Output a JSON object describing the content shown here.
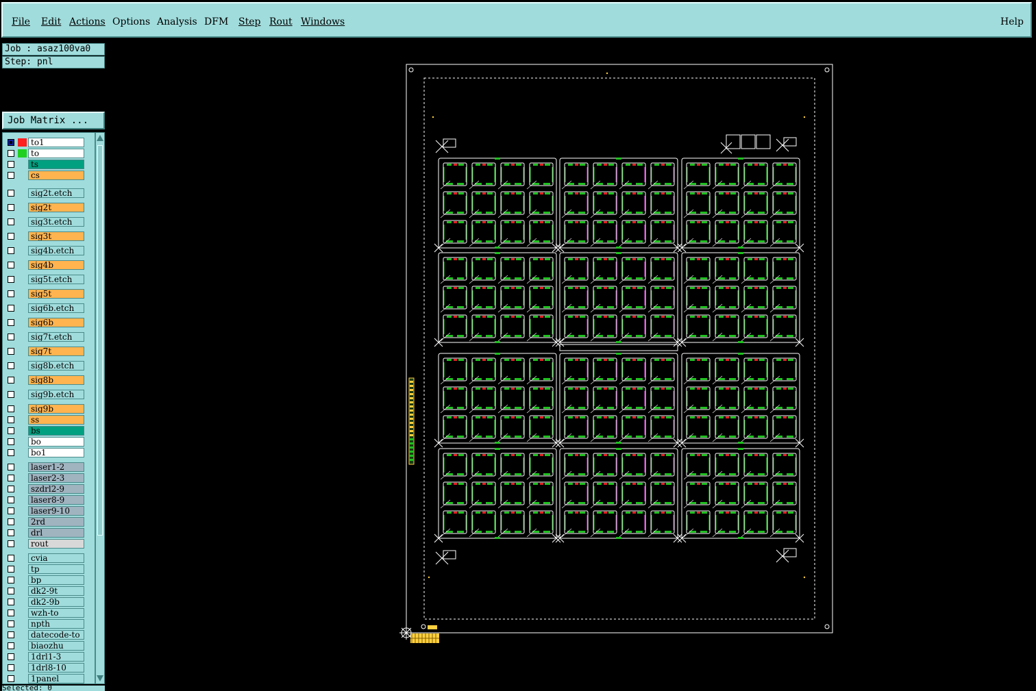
{
  "menubar": {
    "items": [
      "File",
      "Edit",
      "Actions",
      "Options",
      "Analysis",
      "DFM",
      "Step",
      "Rout",
      "Windows"
    ],
    "help": "Help"
  },
  "job": {
    "label": "Job : asaz100va0",
    "step": "Step: pnl",
    "matrix_button": "Job Matrix ..."
  },
  "layers": [
    {
      "name": "to1",
      "color": "#ffffff",
      "swatch": "#ff2020",
      "selected": true
    },
    {
      "name": "to",
      "color": "#ffffff",
      "swatch": "#20d020"
    },
    {
      "name": "ts",
      "color": "#00a080"
    },
    {
      "name": "cs",
      "color": "#ffb450"
    },
    {
      "name": "sig2t.etch",
      "color": "#a0dcdc"
    },
    {
      "name": "sig2t",
      "color": "#ffb450"
    },
    {
      "name": "sig3t.etch",
      "color": "#a0dcdc"
    },
    {
      "name": "sig3t",
      "color": "#ffb450"
    },
    {
      "name": "sig4b.etch",
      "color": "#a0dcdc"
    },
    {
      "name": "sig4b",
      "color": "#ffb450"
    },
    {
      "name": "sig5t.etch",
      "color": "#a0dcdc"
    },
    {
      "name": "sig5t",
      "color": "#ffb450"
    },
    {
      "name": "sig6b.etch",
      "color": "#a0dcdc"
    },
    {
      "name": "sig6b",
      "color": "#ffb450"
    },
    {
      "name": "sig7t.etch",
      "color": "#a0dcdc"
    },
    {
      "name": "sig7t",
      "color": "#ffb450"
    },
    {
      "name": "sig8b.etch",
      "color": "#a0dcdc"
    },
    {
      "name": "sig8b",
      "color": "#ffb450"
    },
    {
      "name": "sig9b.etch",
      "color": "#a0dcdc"
    },
    {
      "name": "sig9b",
      "color": "#ffb450"
    },
    {
      "name": "ss",
      "color": "#ffb450"
    },
    {
      "name": "bs",
      "color": "#00a080"
    },
    {
      "name": "bo",
      "color": "#ffffff"
    },
    {
      "name": "bo1",
      "color": "#ffffff"
    },
    {
      "name": "laser1-2",
      "color": "#a0b4c0"
    },
    {
      "name": "laser2-3",
      "color": "#a0b4c0"
    },
    {
      "name": "szdrl2-9",
      "color": "#a0b4c0"
    },
    {
      "name": "laser8-9",
      "color": "#a0b4c0"
    },
    {
      "name": "laser9-10",
      "color": "#a0b4c0"
    },
    {
      "name": "2rd",
      "color": "#a0b4c0"
    },
    {
      "name": "drl",
      "color": "#a0b4c0"
    },
    {
      "name": "rout",
      "color": "#d8d8d8"
    },
    {
      "name": "cvia",
      "color": "#a0dcdc"
    },
    {
      "name": "tp",
      "color": "#a0dcdc"
    },
    {
      "name": "bp",
      "color": "#a0dcdc"
    },
    {
      "name": "dk2-9t",
      "color": "#a0dcdc"
    },
    {
      "name": "dk2-9b",
      "color": "#a0dcdc"
    },
    {
      "name": "wzh-to",
      "color": "#a0dcdc"
    },
    {
      "name": "npth",
      "color": "#a0dcdc"
    },
    {
      "name": "datecode-to",
      "color": "#a0dcdc"
    },
    {
      "name": "biaozhu",
      "color": "#a0dcdc"
    },
    {
      "name": "1drl1-3",
      "color": "#a0dcdc"
    },
    {
      "name": "1drl8-10",
      "color": "#a0dcdc"
    },
    {
      "name": "1panel",
      "color": "#a0dcdc"
    }
  ],
  "bottom_text": "Selected: 0"
}
